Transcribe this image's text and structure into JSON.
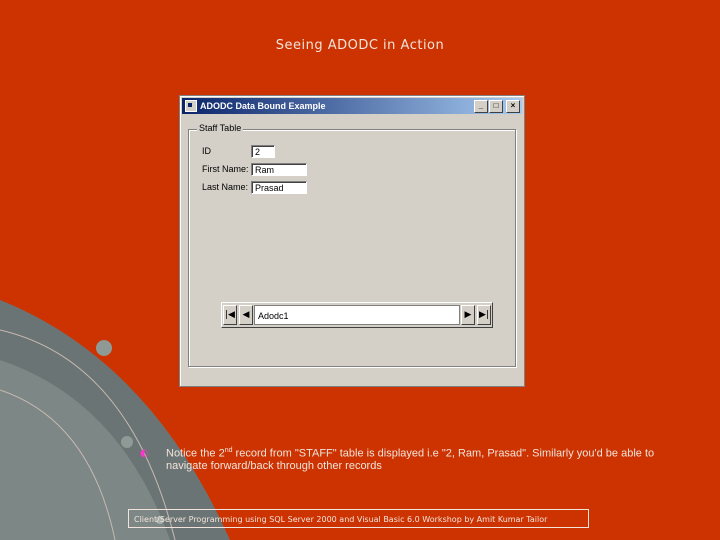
{
  "slide": {
    "title": "Seeing ADODC in Action",
    "note_prefix": "Notice the 2",
    "note_sup": "nd",
    "note_rest": " record from \"STAFF\" table is displayed i.e \"2, Ram, Prasad\". Similarly you'd be able to navigate forward/back through other records",
    "footer": "Client/Server Programming using SQL Server 2000 and Visual Basic 6.0 Workshop by Amit Kumar Tailor"
  },
  "window": {
    "title": "ADODC Data Bound Example",
    "minimize": "_",
    "maximize": "□",
    "close": "×",
    "group_label": "Staff Table",
    "fields": [
      {
        "label": "ID",
        "value": "2"
      },
      {
        "label": "First Name:",
        "value": "Ram"
      },
      {
        "label": "Last Name:",
        "value": "Prasad"
      }
    ],
    "adodc": {
      "caption": "Adodc1",
      "first": "|◀",
      "prev": "◀",
      "next": "▶",
      "last": "▶|"
    }
  },
  "colors": {
    "background": "#cc3300",
    "titlebar": "#0a246a",
    "dialog": "#d4d0c8"
  }
}
